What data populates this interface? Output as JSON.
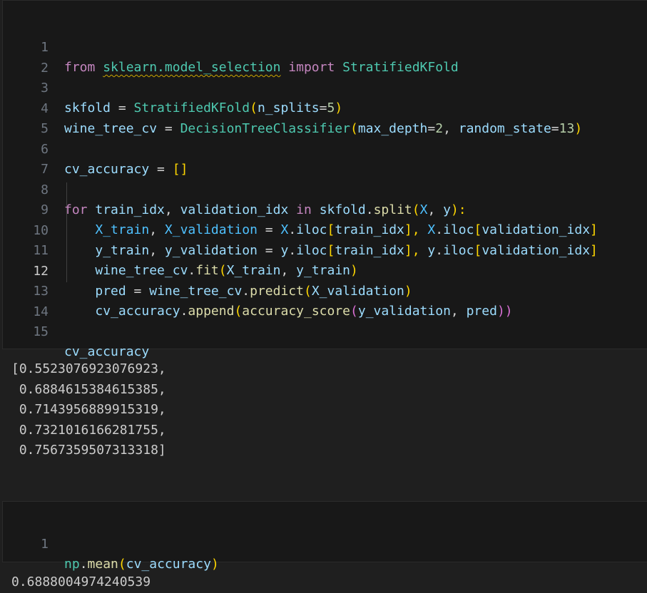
{
  "cell1": {
    "lines": [
      {
        "n": "1",
        "t": [
          "from",
          " ",
          "sklearn.model_selection",
          " ",
          "import",
          " ",
          "StratifiedKFold"
        ]
      },
      {
        "n": "2"
      },
      {
        "n": "3",
        "t": [
          "skfold",
          " = ",
          "StratifiedKFold",
          "(",
          "n_splits",
          "=",
          "5",
          ")"
        ]
      },
      {
        "n": "4",
        "t": [
          "wine_tree_cv",
          " = ",
          "DecisionTreeClassifier",
          "(",
          "max_depth",
          "=",
          "2",
          ", ",
          "random_state",
          "=",
          "13",
          ")"
        ]
      },
      {
        "n": "5"
      },
      {
        "n": "6",
        "t": [
          "cv_accuracy",
          " = ",
          "[]"
        ]
      },
      {
        "n": "7"
      },
      {
        "n": "8",
        "t": [
          "for",
          " ",
          "train_idx",
          ", ",
          "validation_idx",
          " ",
          "in",
          " ",
          "skfold",
          ".",
          "split",
          "(",
          "X",
          ", ",
          "y",
          "):"
        ]
      },
      {
        "n": "9",
        "t": [
          "    ",
          "X_train",
          ", ",
          "X_validation",
          " = ",
          "X",
          ".",
          "iloc",
          "[",
          "train_idx",
          "], ",
          "X",
          ".",
          "iloc",
          "[",
          "validation_idx",
          "]"
        ]
      },
      {
        "n": "10",
        "t": [
          "    ",
          "y_train",
          ", ",
          "y_validation",
          " = ",
          "y",
          ".",
          "iloc",
          "[",
          "train_idx",
          "], ",
          "y",
          ".",
          "iloc",
          "[",
          "validation_idx",
          "]"
        ]
      },
      {
        "n": "11",
        "t": [
          "    ",
          "wine_tree_cv",
          ".",
          "fit",
          "(",
          "X_train",
          ", ",
          "y_train",
          ")"
        ]
      },
      {
        "n": "12",
        "t": [
          "    ",
          "pred",
          " = ",
          "wine_tree_cv",
          ".",
          "predict",
          "(",
          "X_validation",
          ")"
        ]
      },
      {
        "n": "13",
        "t": [
          "    ",
          "cv_accuracy",
          ".",
          "append",
          "(",
          "accuracy_score",
          "(",
          "y_validation",
          ", ",
          "pred",
          "))"
        ]
      },
      {
        "n": "14"
      },
      {
        "n": "15",
        "t": [
          "cv_accuracy"
        ]
      }
    ],
    "output": "[0.5523076923076923,\n 0.6884615384615385,\n 0.7143956889915319,\n 0.7321016166281755,\n 0.7567359507313318]"
  },
  "cell2": {
    "lines": [
      {
        "n": "1",
        "t": [
          "np",
          ".",
          "mean",
          "(",
          "cv_accuracy",
          ")"
        ]
      }
    ],
    "output": "0.6888004974240539"
  },
  "active_line": "12",
  "colors": {
    "keyword": "#c586c0",
    "class": "#4ec9b0",
    "variable": "#9cdcfe",
    "function": "#dcdcaa",
    "number": "#b5cea8",
    "background": "#1f1f1f"
  }
}
